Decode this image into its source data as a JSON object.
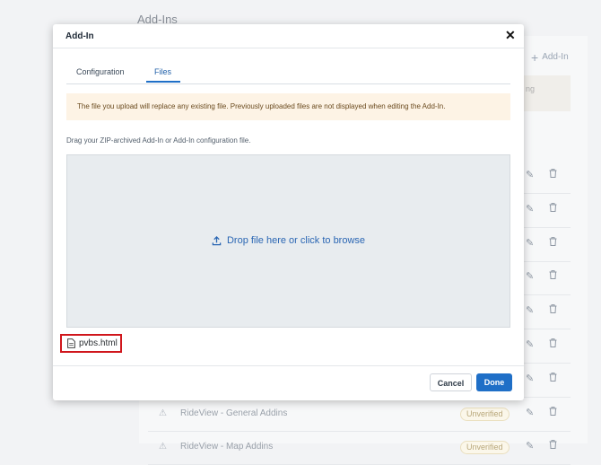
{
  "background": {
    "title": "Add-Ins",
    "add_label": "Add-In",
    "notice_fragment": "ng",
    "rows": [
      {
        "name": ""
      },
      {
        "name": ""
      },
      {
        "name": ""
      },
      {
        "name": ""
      },
      {
        "name": ""
      },
      {
        "name": ""
      },
      {
        "name": ""
      },
      {
        "name": "RideView - General Addins",
        "badge": "Unverified"
      },
      {
        "name": "RideView - Map Addins",
        "badge": "Unverified"
      }
    ]
  },
  "modal": {
    "title": "Add-In",
    "close_label": "✕",
    "tabs": [
      {
        "label": "Configuration",
        "active": false
      },
      {
        "label": "Files",
        "active": true
      }
    ],
    "notice": "The file you upload will replace any existing file. Previously uploaded files are not displayed when editing the Add-In.",
    "drag_label": "Drag your ZIP-archived Add-In or Add-In configuration file.",
    "dropzone_text": "Drop file here or click to browse",
    "file_name": "pvbs.html",
    "cancel_label": "Cancel",
    "done_label": "Done"
  },
  "colors": {
    "accent": "#1f6fc7",
    "highlight": "#d0161c",
    "notice_bg": "#fdf3e5"
  },
  "icons": [
    "plus-icon",
    "close-icon",
    "upload-icon",
    "file-icon",
    "edit-icon",
    "trash-icon",
    "warning-icon"
  ]
}
